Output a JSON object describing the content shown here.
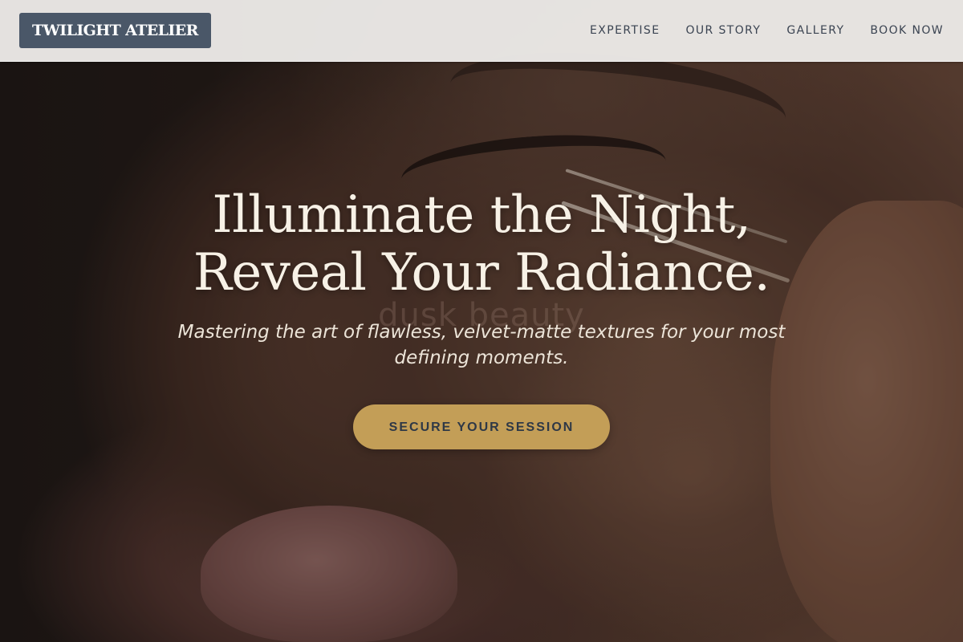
{
  "header": {
    "logo_text": "TWILIGHT ATELIER",
    "nav": [
      {
        "label": "EXPERTISE"
      },
      {
        "label": "OUR STORY"
      },
      {
        "label": "GALLERY"
      },
      {
        "label": "BOOK NOW"
      }
    ]
  },
  "hero": {
    "title_line1": "Illuminate the Night,",
    "title_line2": "Reveal Your Radiance.",
    "watermark": "dusk beauty",
    "subtitle": "Mastering the art of flawless, velvet-matte textures for your most defining moments.",
    "cta_label": "SECURE YOUR SESSION",
    "background_image": "close-up of makeup artist applying cosmetics near eye"
  },
  "colors": {
    "header_bg": "#eceae8",
    "logo_bg": "#4a5768",
    "nav_text": "#3b4452",
    "cta_bg": "#c39e57",
    "cta_text": "#2e3846",
    "title_text": "#f7f1e6"
  }
}
